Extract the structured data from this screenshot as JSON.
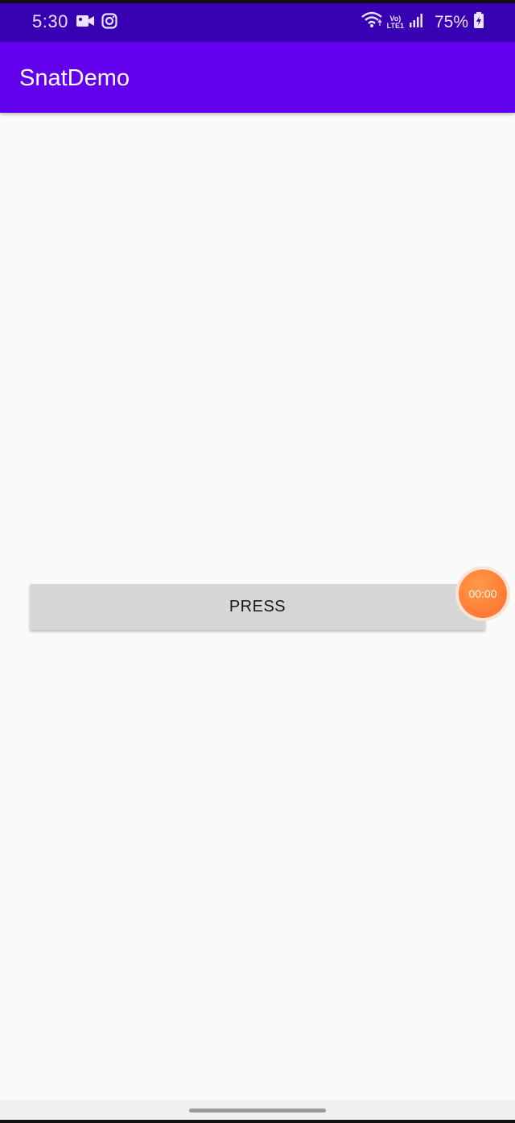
{
  "status_bar": {
    "time": "5:30",
    "battery": "75%",
    "network_label_top": "Vo)",
    "network_label_bottom": "LTE1",
    "left_icons": [
      "video-camera-icon",
      "instagram-icon"
    ],
    "right_icons": [
      "wifi-icon",
      "volte-icon",
      "signal-icon",
      "battery-icon"
    ]
  },
  "app_bar": {
    "title": "SnatDemo",
    "color": "#6200ee"
  },
  "main": {
    "press_button_label": "PRESS"
  },
  "screen_recorder": {
    "timer": "00:00",
    "color": "#ff7a33"
  },
  "colors": {
    "status_bar": "#3700b3",
    "background": "#fafafa",
    "button": "#d6d6d6"
  }
}
